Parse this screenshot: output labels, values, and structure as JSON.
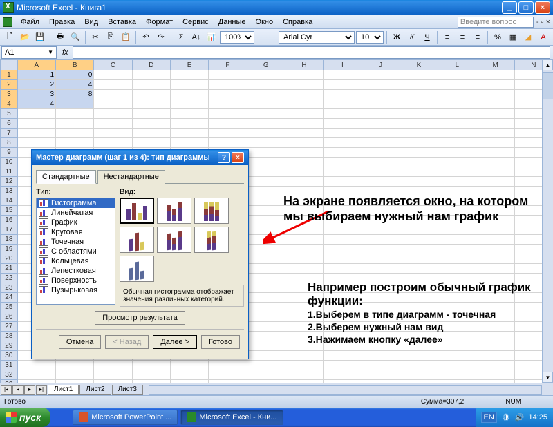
{
  "titlebar": {
    "title": "Microsoft Excel - Книга1"
  },
  "menu": {
    "file": "Файл",
    "edit": "Правка",
    "view": "Вид",
    "insert": "Вставка",
    "format": "Формат",
    "tools": "Сервис",
    "data": "Данные",
    "window": "Окно",
    "help": "Справка",
    "helpbox_placeholder": "Введите вопрос"
  },
  "format_toolbar": {
    "font": "Arial Cyr",
    "size": "10"
  },
  "namebox": "A1",
  "columns": [
    "A",
    "B",
    "C",
    "D",
    "E",
    "F",
    "G",
    "H",
    "I",
    "J",
    "K",
    "L",
    "M",
    "N"
  ],
  "rows_sel_end": 4,
  "cells": {
    "A1": "1",
    "B1": "0",
    "A2": "2",
    "B2": "4",
    "A3": "3",
    "B3": "8",
    "A4": "4"
  },
  "dialog": {
    "title": "Мастер диаграмм (шаг 1 из 4): тип диаграммы",
    "tab_standard": "Стандартные",
    "tab_custom": "Нестандартные",
    "type_label": "Тип:",
    "view_label": "Вид:",
    "types": [
      "Гистограмма",
      "Линейчатая",
      "График",
      "Круговая",
      "Точечная",
      "С областями",
      "Кольцевая",
      "Лепестковая",
      "Поверхность",
      "Пузырьковая"
    ],
    "selected_type_index": 0,
    "description": "Обычная гистограмма отображает значения различных категорий.",
    "preview_btn": "Просмотр результата",
    "btn_cancel": "Отмена",
    "btn_back": "< Назад",
    "btn_next": "Далее >",
    "btn_finish": "Готово"
  },
  "annotations": {
    "line1": "На экране появляется окно, на котором мы выбираем нужный нам график",
    "line2_title": "Например построим обычный график функции:",
    "step1": "1.Выберем в типе диаграмм - точечная",
    "step2": "2.Выберем нужный нам вид",
    "step3": "3.Нажимаем кнопку «далее»"
  },
  "sheets": {
    "s1": "Лист1",
    "s2": "Лист2",
    "s3": "Лист3"
  },
  "statusbar": {
    "ready": "Готово",
    "sum": "Сумма=307,2",
    "num": "NUM"
  },
  "taskbar": {
    "start": "пуск",
    "ppt": "Microsoft PowerPoint ...",
    "xls": "Microsoft Excel - Кни...",
    "lang": "EN",
    "time": "14:25"
  }
}
